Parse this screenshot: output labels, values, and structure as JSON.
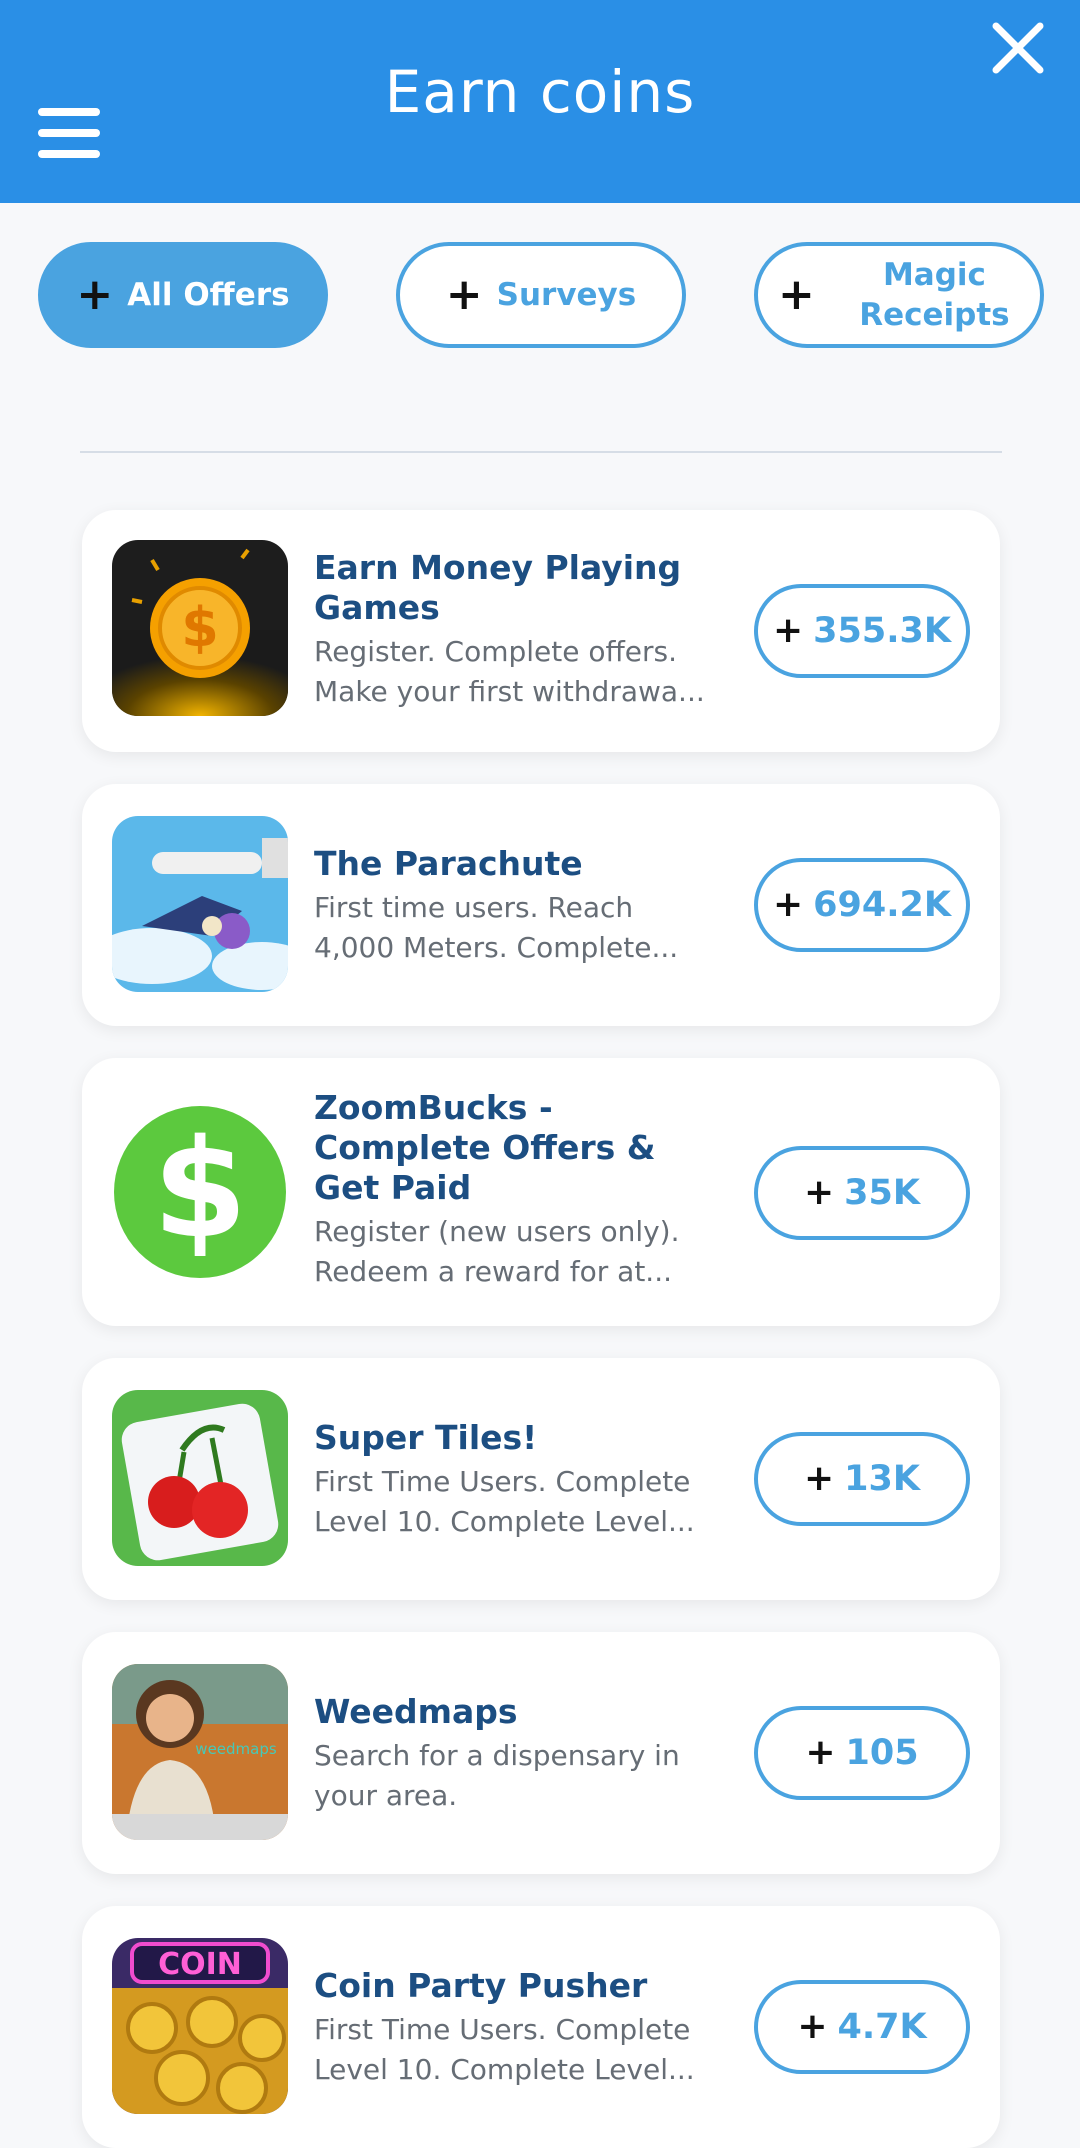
{
  "header": {
    "title": "Earn coins",
    "background": "#2a8fe6"
  },
  "filters": [
    {
      "label": "All Offers",
      "active": true
    },
    {
      "label": "Surveys",
      "active": false
    },
    {
      "label": "Magic Receipts",
      "active": false
    }
  ],
  "offers": [
    {
      "title": "Earn Money Playing Games",
      "description": "Register. Complete offers. Make your first withdrawa...",
      "reward": "355.3K",
      "icon": "gold-coin-icon"
    },
    {
      "title": "The Parachute",
      "description": "First time users. Reach 4,000 Meters. Complete...",
      "reward": "694.2K",
      "icon": "parachute-game-icon"
    },
    {
      "title": "ZoomBucks - Complete Offers & Get Paid",
      "description": "Register (new users only). Redeem a reward for at...",
      "reward": "35K",
      "icon": "green-dollar-icon"
    },
    {
      "title": "Super Tiles!",
      "description": "First Time Users. Complete Level 10. Complete Level...",
      "reward": "13K",
      "icon": "cherry-tile-icon"
    },
    {
      "title": "Weedmaps",
      "description": "Search for a dispensary in your area.",
      "reward": "105",
      "icon": "weedmaps-photo-icon",
      "icon_text": "weedmaps"
    },
    {
      "title": "Coin Party Pusher",
      "description": "First Time Users. Complete Level 10. Complete Level...",
      "reward": "4.7K",
      "icon": "coin-pusher-icon",
      "icon_text": "COIN"
    }
  ],
  "colors": {
    "accent": "#4aa3e0",
    "title": "#1c4e82",
    "description": "#666d75"
  }
}
